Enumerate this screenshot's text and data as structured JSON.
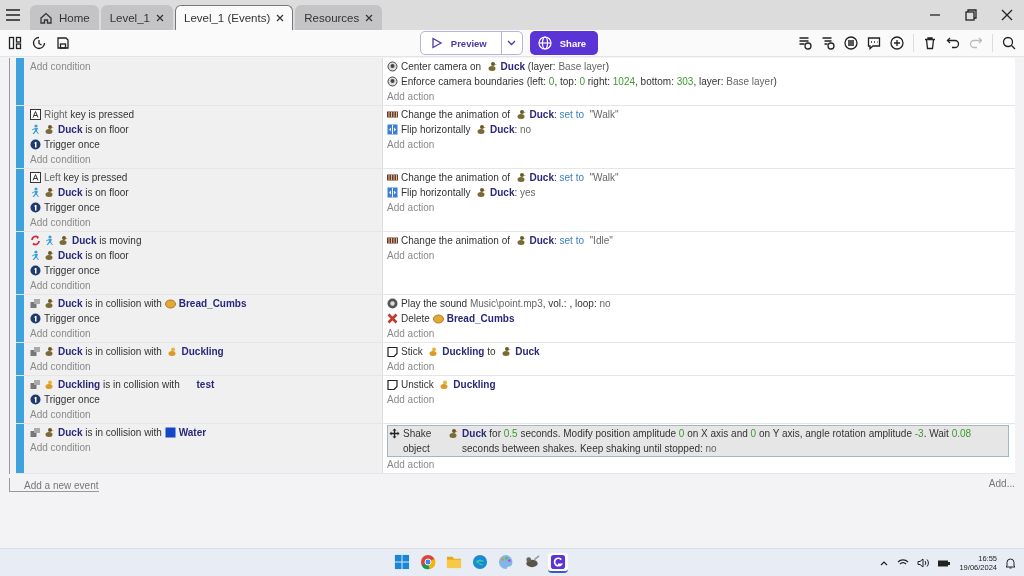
{
  "tabs": [
    {
      "label": "Home",
      "kind": "home",
      "selected": false
    },
    {
      "label": "Level_1",
      "kind": "scene",
      "selected": false
    },
    {
      "label": "Level_1 (Events)",
      "kind": "events",
      "selected": true
    },
    {
      "label": "Resources",
      "kind": "resources",
      "selected": false
    }
  ],
  "toolbar": {
    "preview": "Preview",
    "share": "Share",
    "redo": {
      "disabled": true
    }
  },
  "events": [
    {
      "add_condition": "Add condition",
      "add_action": "Add action",
      "actions": [
        {
          "selected": false,
          "tokens": [
            {
              "kind": "camera"
            },
            {
              "kind": "text",
              "text": "Center camera on  "
            },
            {
              "kind": "duck"
            },
            {
              "kind": "object",
              "text": "Duck"
            },
            {
              "kind": "text",
              "text": " (layer: "
            },
            {
              "kind": "param",
              "text": "Base layer"
            },
            {
              "kind": "text",
              "text": ")"
            }
          ]
        },
        {
          "selected": false,
          "tokens": [
            {
              "kind": "camera"
            },
            {
              "kind": "text",
              "text": "Enforce camera boundaries (left: "
            },
            {
              "kind": "number",
              "text": "0"
            },
            {
              "kind": "text",
              "text": ", top: "
            },
            {
              "kind": "number",
              "text": "0"
            },
            {
              "kind": "text",
              "text": " right: "
            },
            {
              "kind": "number",
              "text": "1024"
            },
            {
              "kind": "text",
              "text": ", bottom: "
            },
            {
              "kind": "number",
              "text": "303"
            },
            {
              "kind": "text",
              "text": ", layer: "
            },
            {
              "kind": "param",
              "text": "Base layer"
            },
            {
              "kind": "text",
              "text": ")"
            }
          ]
        }
      ]
    },
    {
      "add_condition": "Add condition",
      "add_action": "Add action",
      "conditions": [
        {
          "selected": false,
          "tokens": [
            {
              "kind": "key"
            },
            {
              "kind": "param",
              "text": "Right"
            },
            {
              "kind": "text",
              "text": " key is pressed"
            }
          ]
        },
        {
          "selected": false,
          "tokens": [
            {
              "kind": "platformer"
            },
            {
              "kind": "duck"
            },
            {
              "kind": "object",
              "text": "Duck"
            },
            {
              "kind": "text",
              "text": " is on floor"
            }
          ]
        },
        {
          "selected": false,
          "tokens": [
            {
              "kind": "trigger"
            },
            {
              "kind": "text",
              "text": "Trigger once"
            }
          ]
        }
      ],
      "actions": [
        {
          "selected": false,
          "tokens": [
            {
              "kind": "animation"
            },
            {
              "kind": "text",
              "text": "Change the animation of  "
            },
            {
              "kind": "duck"
            },
            {
              "kind": "object",
              "text": "Duck"
            },
            {
              "kind": "text",
              "text": ": "
            },
            {
              "kind": "op",
              "text": "set to"
            },
            {
              "kind": "param",
              "text": "  \"Walk\""
            }
          ]
        },
        {
          "selected": false,
          "tokens": [
            {
              "kind": "flip"
            },
            {
              "kind": "text",
              "text": "Flip horizontally  "
            },
            {
              "kind": "duck"
            },
            {
              "kind": "object",
              "text": "Duck"
            },
            {
              "kind": "text",
              "text": ": "
            },
            {
              "kind": "param",
              "text": "no"
            }
          ]
        }
      ]
    },
    {
      "add_condition": "Add condition",
      "add_action": "Add action",
      "conditions": [
        {
          "selected": false,
          "tokens": [
            {
              "kind": "key"
            },
            {
              "kind": "param",
              "text": "Left"
            },
            {
              "kind": "text",
              "text": " key is pressed"
            }
          ]
        },
        {
          "selected": false,
          "tokens": [
            {
              "kind": "platformer"
            },
            {
              "kind": "duck"
            },
            {
              "kind": "object",
              "text": "Duck"
            },
            {
              "kind": "text",
              "text": " is on floor"
            }
          ]
        },
        {
          "selected": false,
          "tokens": [
            {
              "kind": "trigger"
            },
            {
              "kind": "text",
              "text": "Trigger once"
            }
          ]
        }
      ],
      "actions": [
        {
          "selected": false,
          "tokens": [
            {
              "kind": "animation"
            },
            {
              "kind": "text",
              "text": "Change the animation of  "
            },
            {
              "kind": "duck"
            },
            {
              "kind": "object",
              "text": "Duck"
            },
            {
              "kind": "text",
              "text": ": "
            },
            {
              "kind": "op",
              "text": "set to"
            },
            {
              "kind": "param",
              "text": "  \"Walk\""
            }
          ]
        },
        {
          "selected": false,
          "tokens": [
            {
              "kind": "flip"
            },
            {
              "kind": "text",
              "text": "Flip horizontally  "
            },
            {
              "kind": "duck"
            },
            {
              "kind": "object",
              "text": "Duck"
            },
            {
              "kind": "text",
              "text": ": "
            },
            {
              "kind": "param",
              "text": "yes"
            }
          ]
        }
      ]
    },
    {
      "add_condition": "Add condition",
      "add_action": "Add action",
      "conditions": [
        {
          "selected": false,
          "tokens": [
            {
              "kind": "rotate"
            },
            {
              "kind": "platformer"
            },
            {
              "kind": "duck"
            },
            {
              "kind": "object",
              "text": "Duck"
            },
            {
              "kind": "text",
              "text": " is moving"
            }
          ]
        },
        {
          "selected": false,
          "tokens": [
            {
              "kind": "platformer"
            },
            {
              "kind": "duck"
            },
            {
              "kind": "object",
              "text": "Duck"
            },
            {
              "kind": "text",
              "text": " is on floor"
            }
          ]
        },
        {
          "selected": false,
          "tokens": [
            {
              "kind": "trigger"
            },
            {
              "kind": "text",
              "text": "Trigger once"
            }
          ]
        }
      ],
      "actions": [
        {
          "selected": false,
          "tokens": [
            {
              "kind": "animation"
            },
            {
              "kind": "text",
              "text": "Change the animation of  "
            },
            {
              "kind": "duck"
            },
            {
              "kind": "object",
              "text": "Duck"
            },
            {
              "kind": "text",
              "text": ": "
            },
            {
              "kind": "op",
              "text": "set to"
            },
            {
              "kind": "param",
              "text": "  \"Idle\""
            }
          ]
        }
      ]
    },
    {
      "add_condition": "Add condition",
      "add_action": "Add action",
      "conditions": [
        {
          "selected": false,
          "tokens": [
            {
              "kind": "collision"
            },
            {
              "kind": "duck"
            },
            {
              "kind": "object",
              "text": "Duck"
            },
            {
              "kind": "text",
              "text": " is in collision with "
            },
            {
              "kind": "bread"
            },
            {
              "kind": "object",
              "text": "Bread_Cumbs"
            }
          ]
        },
        {
          "selected": false,
          "tokens": [
            {
              "kind": "trigger"
            },
            {
              "kind": "text",
              "text": "Trigger once"
            }
          ]
        }
      ],
      "actions": [
        {
          "selected": false,
          "tokens": [
            {
              "kind": "sound"
            },
            {
              "kind": "text",
              "text": "Play the sound "
            },
            {
              "kind": "param",
              "text": "Music\\point.mp3"
            },
            {
              "kind": "text",
              "text": ", vol.: , loop: "
            },
            {
              "kind": "param",
              "text": "no"
            }
          ]
        },
        {
          "selected": false,
          "tokens": [
            {
              "kind": "delete"
            },
            {
              "kind": "text",
              "text": "Delete "
            },
            {
              "kind": "bread"
            },
            {
              "kind": "object",
              "text": "Bread_Cumbs"
            }
          ]
        }
      ]
    },
    {
      "add_condition": "Add condition",
      "add_action": "Add action",
      "conditions": [
        {
          "selected": false,
          "tokens": [
            {
              "kind": "collision"
            },
            {
              "kind": "duck"
            },
            {
              "kind": "object",
              "text": "Duck"
            },
            {
              "kind": "text",
              "text": " is in collision with  "
            },
            {
              "kind": "duckling"
            },
            {
              "kind": "object",
              "text": "Duckling"
            }
          ]
        }
      ],
      "actions": [
        {
          "selected": false,
          "tokens": [
            {
              "kind": "stick"
            },
            {
              "kind": "text",
              "text": "Stick  "
            },
            {
              "kind": "duckling"
            },
            {
              "kind": "object",
              "text": "Duckling"
            },
            {
              "kind": "text",
              "text": " to  "
            },
            {
              "kind": "duck"
            },
            {
              "kind": "object",
              "text": "Duck"
            }
          ]
        }
      ]
    },
    {
      "add_condition": "Add condition",
      "add_action": "Add action",
      "conditions": [
        {
          "selected": false,
          "tokens": [
            {
              "kind": "collision"
            },
            {
              "kind": "duckling"
            },
            {
              "kind": "object",
              "text": "Duckling"
            },
            {
              "kind": "text",
              "text": " is in collision with "
            },
            {
              "kind": "none"
            },
            {
              "kind": "object",
              "text": "test"
            }
          ]
        },
        {
          "selected": false,
          "tokens": [
            {
              "kind": "trigger"
            },
            {
              "kind": "text",
              "text": "Trigger once"
            }
          ]
        }
      ],
      "actions": [
        {
          "selected": false,
          "tokens": [
            {
              "kind": "stick"
            },
            {
              "kind": "text",
              "text": "Unstick  "
            },
            {
              "kind": "duckling"
            },
            {
              "kind": "object",
              "text": "Duckling"
            }
          ]
        }
      ]
    },
    {
      "add_condition": "Add condition",
      "add_action": "Add action",
      "conditions": [
        {
          "selected": false,
          "tokens": [
            {
              "kind": "collision"
            },
            {
              "kind": "duck"
            },
            {
              "kind": "object",
              "text": "Duck"
            },
            {
              "kind": "text",
              "text": " is in collision with "
            },
            {
              "kind": "water"
            },
            {
              "kind": "object",
              "text": "Water"
            }
          ]
        }
      ],
      "actions": [
        {
          "selected": true,
          "tokens": [
            {
              "kind": "shake"
            },
            {
              "kind": "text",
              "text": "Shake object  "
            },
            {
              "kind": "duck"
            },
            {
              "kind": "object",
              "text": "Duck"
            },
            {
              "kind": "text",
              "text": " for "
            },
            {
              "kind": "number",
              "text": "0.5"
            },
            {
              "kind": "text",
              "text": " seconds. Modify position amplitude "
            },
            {
              "kind": "number",
              "text": "0"
            },
            {
              "kind": "text",
              "text": " on X axis and "
            },
            {
              "kind": "number",
              "text": "0"
            },
            {
              "kind": "text",
              "text": " on Y axis, angle rotation amplitude "
            },
            {
              "kind": "number",
              "text": "-3"
            },
            {
              "kind": "text",
              "text": ". Wait "
            },
            {
              "kind": "number",
              "text": "0.08"
            },
            {
              "kind": "text",
              "text": " seconds between shakes. Keep shaking until stopped: "
            },
            {
              "kind": "param",
              "text": "no"
            }
          ]
        }
      ]
    }
  ],
  "add_event": "Add a new event",
  "add_more": "Add...",
  "taskbar": {
    "apps": [
      {
        "kind": "start",
        "selected": false
      },
      {
        "kind": "chrome",
        "selected": false
      },
      {
        "kind": "folder",
        "selected": false
      },
      {
        "kind": "edge",
        "selected": false
      },
      {
        "kind": "paint",
        "selected": false
      },
      {
        "kind": "gimp",
        "selected": false
      },
      {
        "kind": "gdevelop",
        "selected": true
      }
    ],
    "time": "16:55",
    "date": "19/06/2024"
  }
}
